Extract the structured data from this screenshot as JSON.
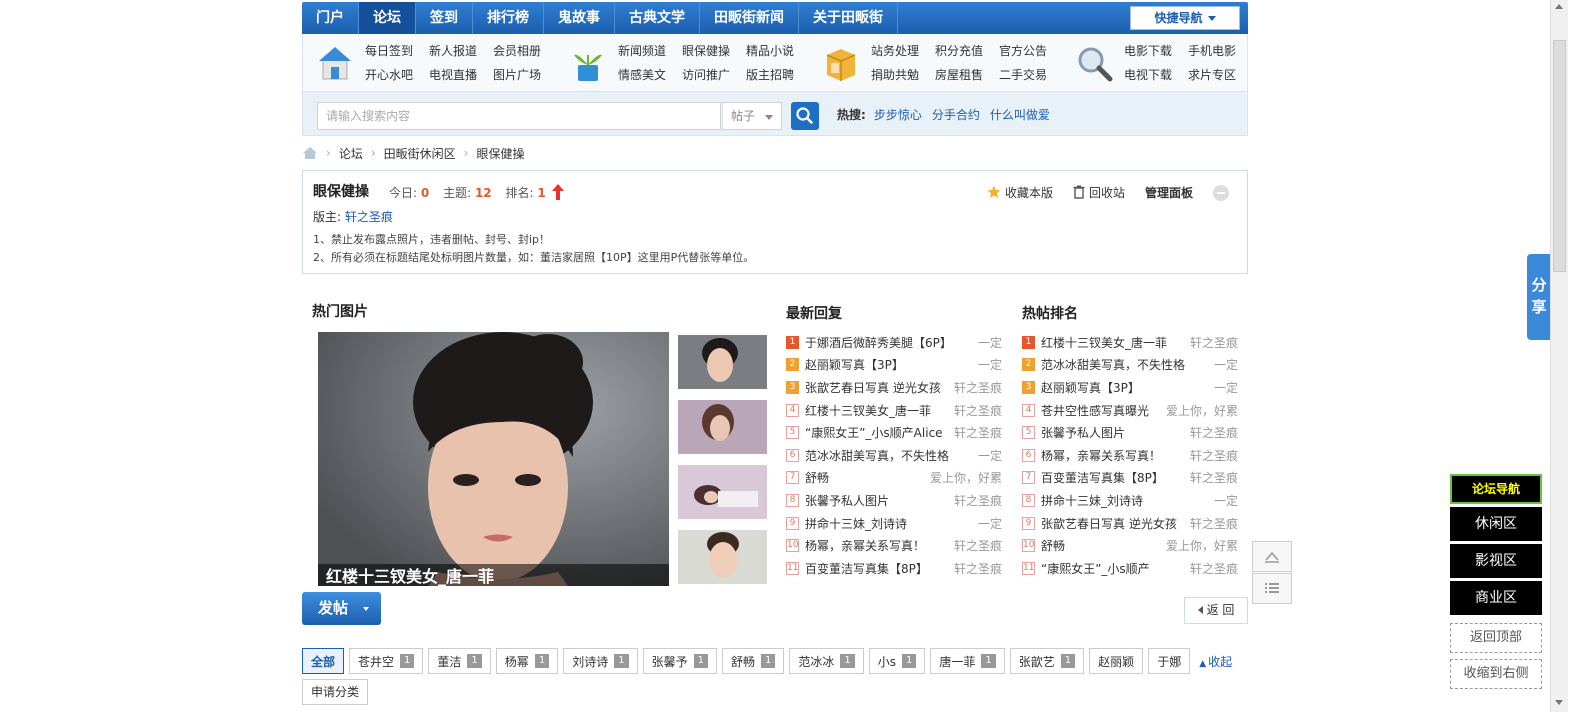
{
  "nav": {
    "items": [
      "门户",
      "论坛",
      "签到",
      "排行榜",
      "鬼故事",
      "古典文学",
      "田畈街新闻",
      "关于田畈街"
    ],
    "active_index": 1,
    "quick": "快捷导航"
  },
  "subnav": [
    {
      "icon": "home-icon",
      "links": [
        "每日签到",
        "新人报道",
        "会员相册",
        "开心水吧",
        "电视直播",
        "图片广场"
      ]
    },
    {
      "icon": "plant-icon",
      "links": [
        "新闻频道",
        "眼保健操",
        "精品小说",
        "情感美文",
        "访问推广",
        "版主招聘"
      ]
    },
    {
      "icon": "box-icon",
      "links": [
        "站务处理",
        "积分充值",
        "官方公告",
        "捐助共勉",
        "房屋租售",
        "二手交易"
      ]
    },
    {
      "icon": "magnifier-icon",
      "links": [
        "电影下载",
        "手机电影",
        "电视下载",
        "求片专区"
      ]
    }
  ],
  "search": {
    "placeholder": "请输入搜索内容",
    "type": "帖子",
    "hot_label": "热搜:",
    "hot": [
      "步步惊心",
      "分手合约",
      "什么叫做爱"
    ]
  },
  "breadcrumb": [
    "论坛",
    "田畈街休闲区",
    "眼保健操"
  ],
  "forum": {
    "title": "眼保健操",
    "today_label": "今日:",
    "today": "0",
    "topics_label": "主题:",
    "topics": "12",
    "rank_label": "排名:",
    "rank": "1",
    "favorite": "收藏本版",
    "recycle": "回收站",
    "admin": "管理面板",
    "mod_label": "版主:",
    "mod": "轩之圣痕",
    "rules": [
      "1、禁止发布露点照片，违者删帖、封号、封ip！",
      "2、所有必须在标题结尾处标明图片数量，如：董洁家居照【10P】这里用P代替张等单位。"
    ]
  },
  "hot_pics": {
    "title": "热门图片",
    "caption": "红楼十三钗美女_唐一菲"
  },
  "latest": {
    "title": "最新回复",
    "rows": [
      {
        "t": "于娜酒后微醉秀美腿【6P】",
        "a": "一定"
      },
      {
        "t": "赵丽颖写真【3P】",
        "a": "一定"
      },
      {
        "t": "张歆艺春日写真 逆光女孩",
        "a": "轩之圣痕"
      },
      {
        "t": "红楼十三钗美女_唐一菲",
        "a": "轩之圣痕"
      },
      {
        "t": "“康熙女王”_小s顺产Alice",
        "a": "轩之圣痕"
      },
      {
        "t": "范冰冰甜美写真，不失性格",
        "a": "一定"
      },
      {
        "t": "舒畅",
        "a": "爱上你，好累"
      },
      {
        "t": "张馨予私人图片",
        "a": "轩之圣痕"
      },
      {
        "t": "拼命十三妹_刘诗诗",
        "a": "一定"
      },
      {
        "t": "杨幂，亲幂关系写真！",
        "a": "轩之圣痕"
      },
      {
        "t": "百变董洁写真集【8P】",
        "a": "轩之圣痕"
      }
    ]
  },
  "ranking": {
    "title": "热帖排名",
    "rows": [
      {
        "t": "红楼十三钗美女_唐一菲",
        "a": "轩之圣痕"
      },
      {
        "t": "范冰冰甜美写真，不失性格",
        "a": "一定"
      },
      {
        "t": "赵丽颖写真【3P】",
        "a": "一定"
      },
      {
        "t": "苍井空性感写真曝光",
        "a": "爱上你，好累"
      },
      {
        "t": "张馨予私人图片",
        "a": "轩之圣痕"
      },
      {
        "t": "杨幂，亲幂关系写真！",
        "a": "轩之圣痕"
      },
      {
        "t": "百变董洁写真集【8P】",
        "a": "轩之圣痕"
      },
      {
        "t": "拼命十三妹_刘诗诗",
        "a": "一定"
      },
      {
        "t": "张歆艺春日写真 逆光女孩",
        "a": "轩之圣痕"
      },
      {
        "t": "舒畅",
        "a": "爱上你，好累"
      },
      {
        "t": "“康熙女王”_小s顺产",
        "a": "轩之圣痕"
      }
    ]
  },
  "post_btn": "发帖",
  "back_btn": "返 回",
  "tags": [
    {
      "l": "全部",
      "c": ""
    },
    {
      "l": "苍井空",
      "c": "1"
    },
    {
      "l": "董洁",
      "c": "1"
    },
    {
      "l": "杨幂",
      "c": "1"
    },
    {
      "l": "刘诗诗",
      "c": "1"
    },
    {
      "l": "张馨予",
      "c": "1"
    },
    {
      "l": "舒畅",
      "c": "1"
    },
    {
      "l": "范冰冰",
      "c": "1"
    },
    {
      "l": "小s",
      "c": "1"
    },
    {
      "l": "唐一菲",
      "c": "1"
    },
    {
      "l": "张歆艺",
      "c": "1"
    },
    {
      "l": "赵丽颖",
      "c": ""
    },
    {
      "l": "于娜",
      "c": ""
    }
  ],
  "fold": "收起",
  "apply": "申请分类",
  "share": "分享",
  "float_nav": {
    "head": "论坛导航",
    "items": [
      "休闲区",
      "影视区",
      "商业区"
    ],
    "back_top": "返回顶部",
    "collapse": "收缩到右侧"
  }
}
